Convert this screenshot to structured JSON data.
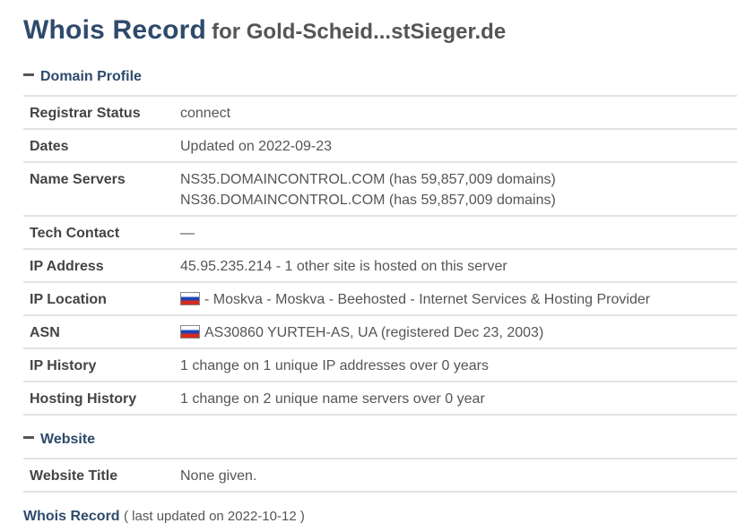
{
  "title": {
    "main": "Whois Record",
    "for": "for Gold-Scheid...stSieger.de"
  },
  "sections": {
    "domain_profile": "Domain Profile",
    "website": "Website"
  },
  "domain_profile": {
    "registrar_status": {
      "label": "Registrar Status",
      "value": "connect"
    },
    "dates": {
      "label": "Dates",
      "value": "Updated on 2022-09-23"
    },
    "name_servers": {
      "label": "Name Servers",
      "ns1": "NS35.DOMAINCONTROL.COM (has 59,857,009 domains)",
      "ns2": "NS36.DOMAINCONTROL.COM (has 59,857,009 domains)"
    },
    "tech_contact": {
      "label": "Tech Contact",
      "value": "—"
    },
    "ip_address": {
      "label": "IP Address",
      "value": "45.95.235.214 - 1 other site is hosted on this server"
    },
    "ip_location": {
      "label": "IP Location",
      "value": "- Moskva - Moskva - Beehosted - Internet Services & Hosting Provider",
      "flag": "russia-flag-icon"
    },
    "asn": {
      "label": "ASN",
      "value": "AS30860 YURTEH-AS, UA (registered Dec 23, 2003)",
      "flag": "russia-flag-icon"
    },
    "ip_history": {
      "label": "IP History",
      "value": "1 change on 1 unique IP addresses over 0 years"
    },
    "hosting_history": {
      "label": "Hosting History",
      "value": "1 change on 2 unique name servers over 0 year"
    }
  },
  "website": {
    "title": {
      "label": "Website Title",
      "value": "None given."
    }
  },
  "footer": {
    "link": "Whois Record",
    "note": "( last updated on 2022-10-12 )"
  },
  "colors": {
    "heading": "#2e4a6b",
    "text": "#555555",
    "border": "#e2e2e2"
  }
}
